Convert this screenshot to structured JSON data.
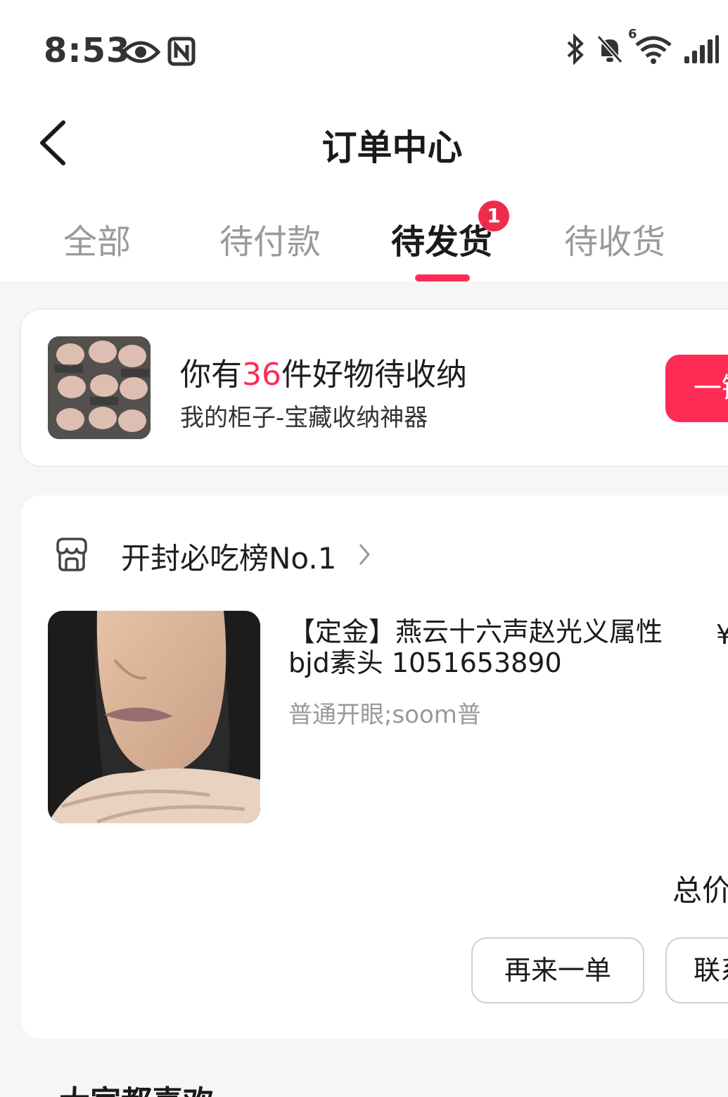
{
  "status_bar": {
    "time": "8:53",
    "icons": [
      "eye-icon",
      "nfc-icon",
      "bluetooth-icon",
      "mute-icon",
      "wifi-icon",
      "signal-icon"
    ],
    "wifi_label": "6"
  },
  "header": {
    "title": "订单中心",
    "back_icon": "back-chevron-icon"
  },
  "tabs": [
    {
      "label": "全部",
      "active": false
    },
    {
      "label": "待付款",
      "active": false
    },
    {
      "label": "待发货",
      "active": true,
      "badge": "1"
    },
    {
      "label": "待收货",
      "active": false
    }
  ],
  "promo": {
    "title_prefix": "你有",
    "title_count": "36",
    "title_suffix": "件好物待收纳",
    "subtitle": "我的柜子-宝藏收纳神器",
    "button_label": "一键"
  },
  "order": {
    "shop_name": "开封必吃榜No.1",
    "product_title": "【定金】燕云十六声赵光义属性bjd素头 1051653890",
    "price": "¥",
    "spec": "普通开眼;soom普",
    "total_label": "总价",
    "buttons": {
      "reorder": "再来一单",
      "contact": "联系"
    }
  },
  "next_section_title": "大家都喜欢",
  "colors": {
    "accent": "#fe2c55",
    "badge": "#ef2b4c",
    "muted_text": "#9a9a9a"
  }
}
